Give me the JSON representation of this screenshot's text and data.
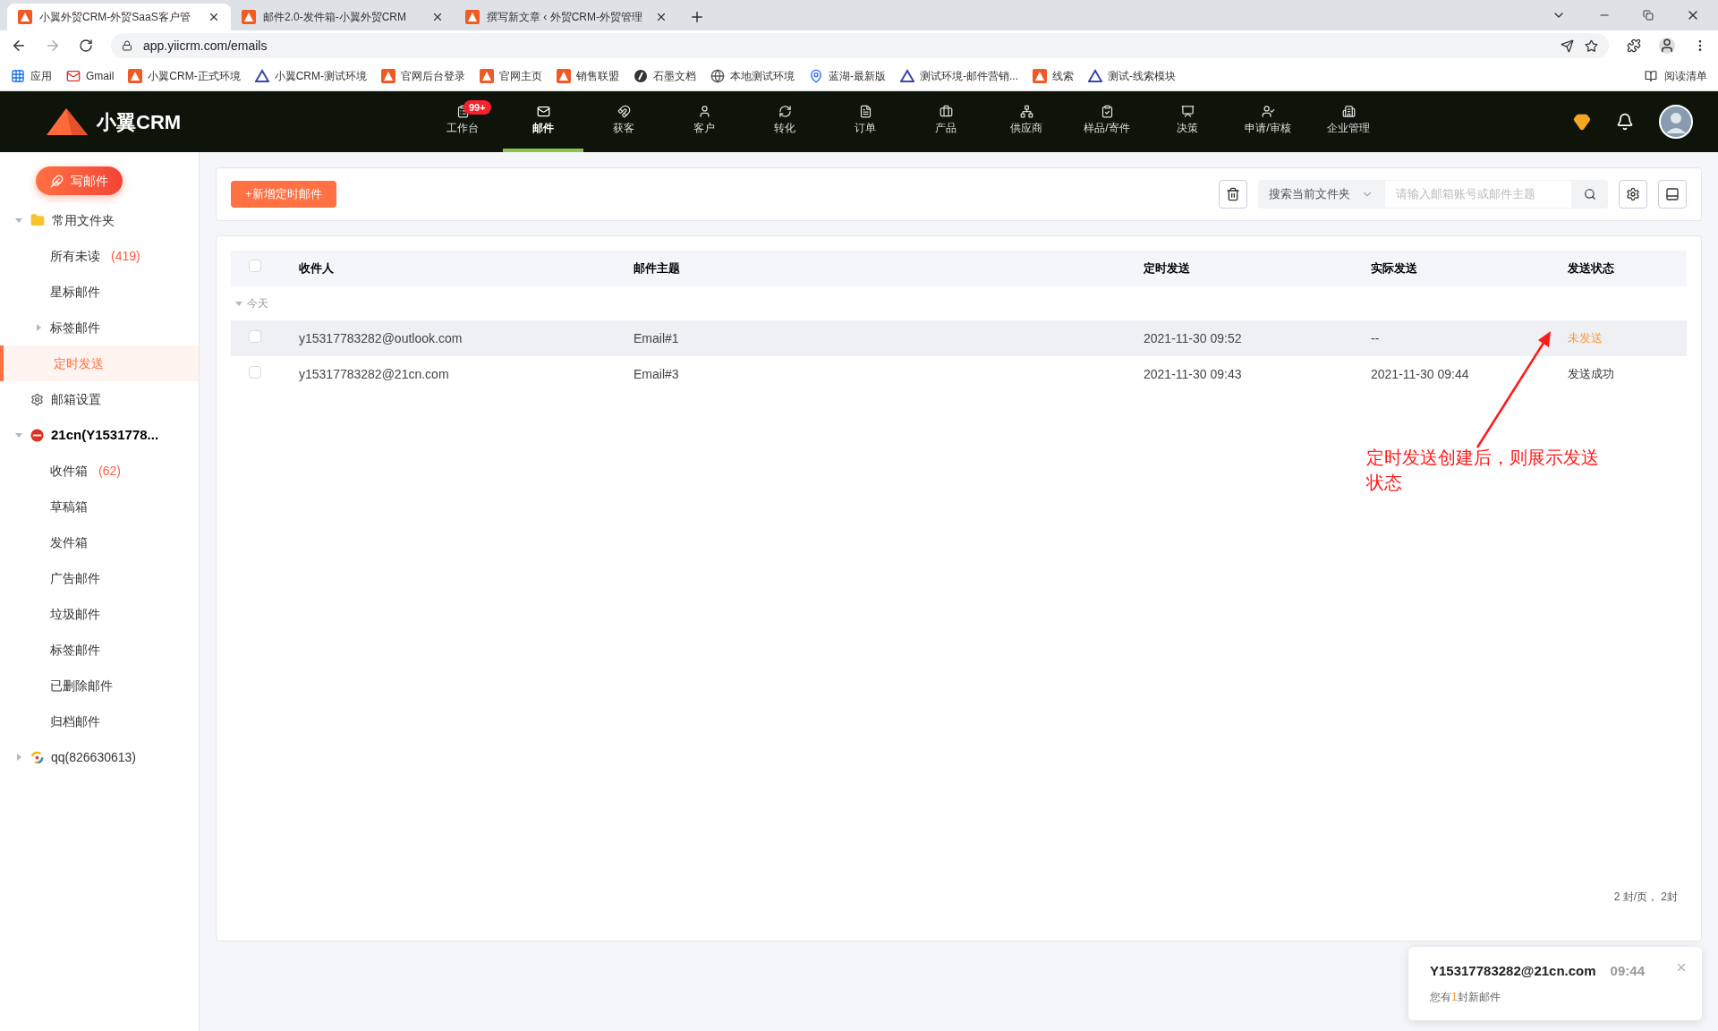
{
  "browser": {
    "tabs": [
      {
        "title": "小翼外贸CRM-外贸SaaS客户管",
        "selected": true
      },
      {
        "title": "邮件2.0-发件箱-小翼外贸CRM",
        "selected": false
      },
      {
        "title": "撰写新文章 ‹ 外贸CRM-外贸管理",
        "selected": false
      }
    ],
    "url": "app.yiicrm.com/emails",
    "bookmarks": [
      {
        "label": "应用",
        "kind": "apps"
      },
      {
        "label": "Gmail",
        "kind": "gmail"
      },
      {
        "label": "小翼CRM-正式环境",
        "kind": "orange"
      },
      {
        "label": "小翼CRM-测试环境",
        "kind": "blue"
      },
      {
        "label": "官网后台登录",
        "kind": "orange"
      },
      {
        "label": "官网主页",
        "kind": "orange"
      },
      {
        "label": "销售联盟",
        "kind": "orange"
      },
      {
        "label": "石墨文档",
        "kind": "doc"
      },
      {
        "label": "本地测试环境",
        "kind": "globe"
      },
      {
        "label": "蓝湖-最新版",
        "kind": "pin"
      },
      {
        "label": "测试环境-邮件营销...",
        "kind": "blue"
      },
      {
        "label": "线索",
        "kind": "orange"
      },
      {
        "label": "测试-线索模块",
        "kind": "blue"
      }
    ],
    "reading_list": "阅读清单"
  },
  "app": {
    "logo": "小翼CRM",
    "nav": [
      {
        "label": "工作台",
        "badge": "99+",
        "selected": false
      },
      {
        "label": "邮件",
        "selected": true
      },
      {
        "label": "获客",
        "selected": false
      },
      {
        "label": "客户",
        "selected": false
      },
      {
        "label": "转化",
        "selected": false
      },
      {
        "label": "订单",
        "selected": false
      },
      {
        "label": "产品",
        "selected": false
      },
      {
        "label": "供应商",
        "selected": false
      },
      {
        "label": "样品/寄件",
        "selected": false
      },
      {
        "label": "决策",
        "selected": false
      },
      {
        "label": "申请/审核",
        "selected": false
      },
      {
        "label": "企业管理",
        "selected": false
      }
    ]
  },
  "sidebar": {
    "compose": "写邮件",
    "tree": [
      {
        "label": "常用文件夹",
        "kind": "folder",
        "expanded": true,
        "children": [
          {
            "label": "所有未读",
            "count": "(419)",
            "selected": false
          },
          {
            "label": "星标邮件",
            "selected": false
          },
          {
            "label": "标签邮件",
            "expanded": false,
            "selected": false
          },
          {
            "label": "定时发送",
            "selected": true
          }
        ]
      },
      {
        "label": "邮箱设置",
        "kind": "settings"
      },
      {
        "label": "21cn(Y1531778...",
        "kind": "account21",
        "expanded": true,
        "children": [
          {
            "label": "收件箱",
            "count": "(62)",
            "selected": false
          },
          {
            "label": "草稿箱",
            "selected": false
          },
          {
            "label": "发件箱",
            "selected": false
          },
          {
            "label": "广告邮件",
            "selected": false
          },
          {
            "label": "垃圾邮件",
            "selected": false
          },
          {
            "label": "标签邮件",
            "selected": false
          },
          {
            "label": "已删除邮件",
            "selected": false
          },
          {
            "label": "归档邮件",
            "selected": false
          }
        ]
      },
      {
        "label": "qq(826630613)",
        "kind": "accountqq",
        "expanded": false
      }
    ]
  },
  "toolbar": {
    "new_button": "+新增定时邮件",
    "scope": "搜索当前文件夹",
    "search": {
      "placeholder": "请输入邮箱账号或邮件主题"
    }
  },
  "table": {
    "columns": [
      "收件人",
      "邮件主题",
      "定时发送",
      "实际发送",
      "发送状态"
    ],
    "select_all_checked": false,
    "group": "今天",
    "rows": [
      {
        "checked": false,
        "highlighted": true,
        "cells": [
          "y15317783282@outlook.com",
          "Email#1",
          "2021-11-30 09:52",
          "--",
          "未发送"
        ],
        "kind": "pending"
      },
      {
        "checked": false,
        "highlighted": false,
        "cells": [
          "y15317783282@21cn.com",
          "Email#3",
          "2021-11-30 09:43",
          "2021-11-30 09:44",
          "发送成功"
        ],
        "kind": "sent"
      }
    ],
    "footer": "2 封/页， 2封"
  },
  "annotation": "定时发送创建后，则展示发送状态",
  "toast": {
    "sender": "Y15317783282@21cn.com",
    "time": "09:44",
    "message_before": "您有",
    "message_count": "1",
    "message_after": "封新邮件"
  }
}
